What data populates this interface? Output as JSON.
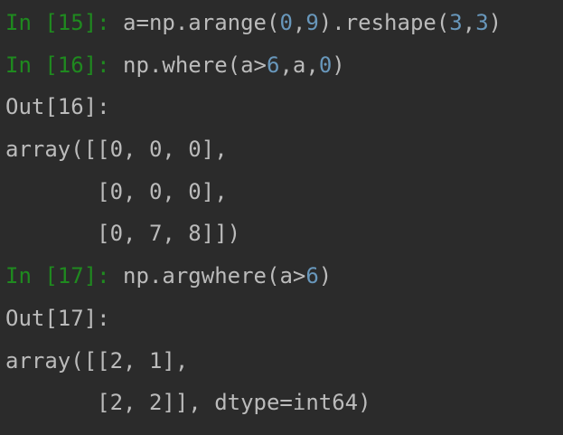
{
  "colors": {
    "background": "#2b2b2b",
    "prompt": "#1f8a1f",
    "number": "#6897bb",
    "text": "#bbbbbb"
  },
  "lines": [
    [
      {
        "t": "In [15]: ",
        "c": "prompt"
      },
      {
        "t": "a=np.arange(",
        "c": "code"
      },
      {
        "t": "0",
        "c": "num"
      },
      {
        "t": ",",
        "c": "code"
      },
      {
        "t": "9",
        "c": "num"
      },
      {
        "t": ").reshape(",
        "c": "code"
      },
      {
        "t": "3",
        "c": "num"
      },
      {
        "t": ",",
        "c": "code"
      },
      {
        "t": "3",
        "c": "num"
      },
      {
        "t": ")",
        "c": "code"
      }
    ],
    [
      {
        "t": "In [16]: ",
        "c": "prompt"
      },
      {
        "t": "np.where(a>",
        "c": "code"
      },
      {
        "t": "6",
        "c": "num"
      },
      {
        "t": ",a,",
        "c": "code"
      },
      {
        "t": "0",
        "c": "num"
      },
      {
        "t": ")",
        "c": "code"
      }
    ],
    [
      {
        "t": "Out[16]:",
        "c": "out"
      }
    ],
    [
      {
        "t": "array([[0, 0, 0],",
        "c": "out"
      }
    ],
    [
      {
        "t": "       [0, 0, 0],",
        "c": "out"
      }
    ],
    [
      {
        "t": "       [0, 7, 8]])",
        "c": "out"
      }
    ],
    [
      {
        "t": "In [17]: ",
        "c": "prompt"
      },
      {
        "t": "np.argwhere(a>",
        "c": "code"
      },
      {
        "t": "6",
        "c": "num"
      },
      {
        "t": ")",
        "c": "code"
      }
    ],
    [
      {
        "t": "Out[17]:",
        "c": "out"
      }
    ],
    [
      {
        "t": "array([[2, 1],",
        "c": "out"
      }
    ],
    [
      {
        "t": "       [2, 2]], dtype=int64)",
        "c": "out"
      }
    ]
  ]
}
